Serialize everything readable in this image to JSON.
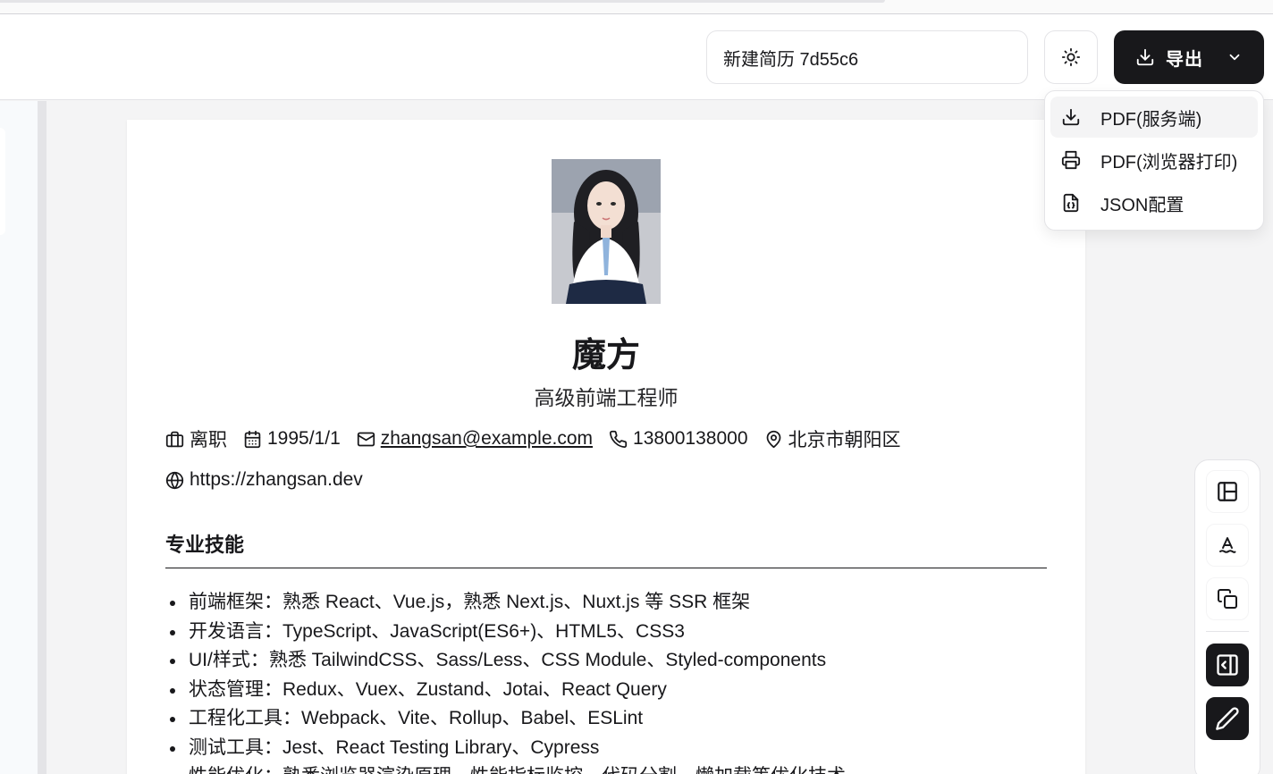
{
  "header": {
    "resume_title": "新建简历 7d55c6",
    "export_label": "导出"
  },
  "export_menu": {
    "items": [
      {
        "label": "PDF(服务端)",
        "icon": "download-icon"
      },
      {
        "label": "PDF(浏览器打印)",
        "icon": "printer-icon"
      },
      {
        "label": "JSON配置",
        "icon": "file-json-icon"
      }
    ]
  },
  "resume": {
    "name": "魔方",
    "job_title": "高级前端工程师",
    "info": {
      "status": "离职",
      "birthday": "1995/1/1",
      "email": "zhangsan@example.com",
      "phone": "13800138000",
      "location": "北京市朝阳区",
      "website": "https://zhangsan.dev"
    },
    "skills_section": {
      "title": "专业技能",
      "items": [
        "前端框架：熟悉 React、Vue.js，熟悉 Next.js、Nuxt.js 等 SSR 框架",
        "开发语言：TypeScript、JavaScript(ES6+)、HTML5、CSS3",
        "UI/样式：熟悉 TailwindCSS、Sass/Less、CSS Module、Styled-components",
        "状态管理：Redux、Vuex、Zustand、Jotai、React Query",
        "工程化工具：Webpack、Vite、Rollup、Babel、ESLint",
        "测试工具：Jest、React Testing Library、Cypress",
        "性能优化：熟悉浏览器渲染原理、性能指标监控、代码分割、懒加载等优化技术"
      ]
    }
  },
  "toolbar": {
    "tools": [
      "layout-panel-icon",
      "font-style-icon",
      "copy-icon",
      "toggle-sidebar-icon",
      "edit-pen-icon"
    ]
  },
  "colors": {
    "primary_dark": "#18181b",
    "border": "#e4e4e7",
    "background": "#f4f4f5"
  }
}
